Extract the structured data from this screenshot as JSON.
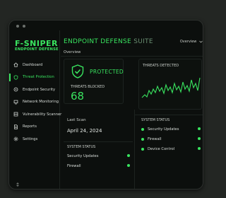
{
  "brand": {
    "name": "F-SNIPER",
    "tagline": "ENDPOINT DEFENSE",
    "accent": "#39e45f"
  },
  "header": {
    "title_bold": "ENDPOINT DEFENSE",
    "title_thin": "SUITE",
    "view_select": "Overview"
  },
  "breadcrumb": "Overview",
  "sidebar": {
    "items": [
      {
        "label": "Dashboard",
        "icon": "home-icon",
        "active": false
      },
      {
        "label": "Threat Protection",
        "icon": "shield-icon",
        "active": true
      },
      {
        "label": "Endpoint Security",
        "icon": "lock-icon",
        "active": false
      },
      {
        "label": "Network Monitoring",
        "icon": "network-icon",
        "active": false
      },
      {
        "label": "Vulnerability Scanner",
        "icon": "scanner-icon",
        "active": false
      },
      {
        "label": "Reports",
        "icon": "reports-icon",
        "active": false
      },
      {
        "label": "Settings",
        "icon": "gear-icon",
        "active": false
      }
    ]
  },
  "status": {
    "label": "PROTECTED",
    "threats_blocked_label": "THREATS BLOCKED",
    "threats_blocked": "68"
  },
  "threats_detected": {
    "label": "THREATS DETECTED"
  },
  "last_scan": {
    "label": "Last Scan",
    "date": "April 24, 2024"
  },
  "system_status_left": {
    "title": "SYSTEM STATUS",
    "items": [
      {
        "label": "Security Updates",
        "status": "ok"
      },
      {
        "label": "Firewall",
        "status": "ok"
      }
    ]
  },
  "system_status_right": {
    "title": "SYSTEM STATUS",
    "items": [
      {
        "label": "Security Updates",
        "status": "ok"
      },
      {
        "label": "Firewall",
        "status": "ok"
      },
      {
        "label": "Device Control",
        "status": "ok"
      }
    ]
  }
}
